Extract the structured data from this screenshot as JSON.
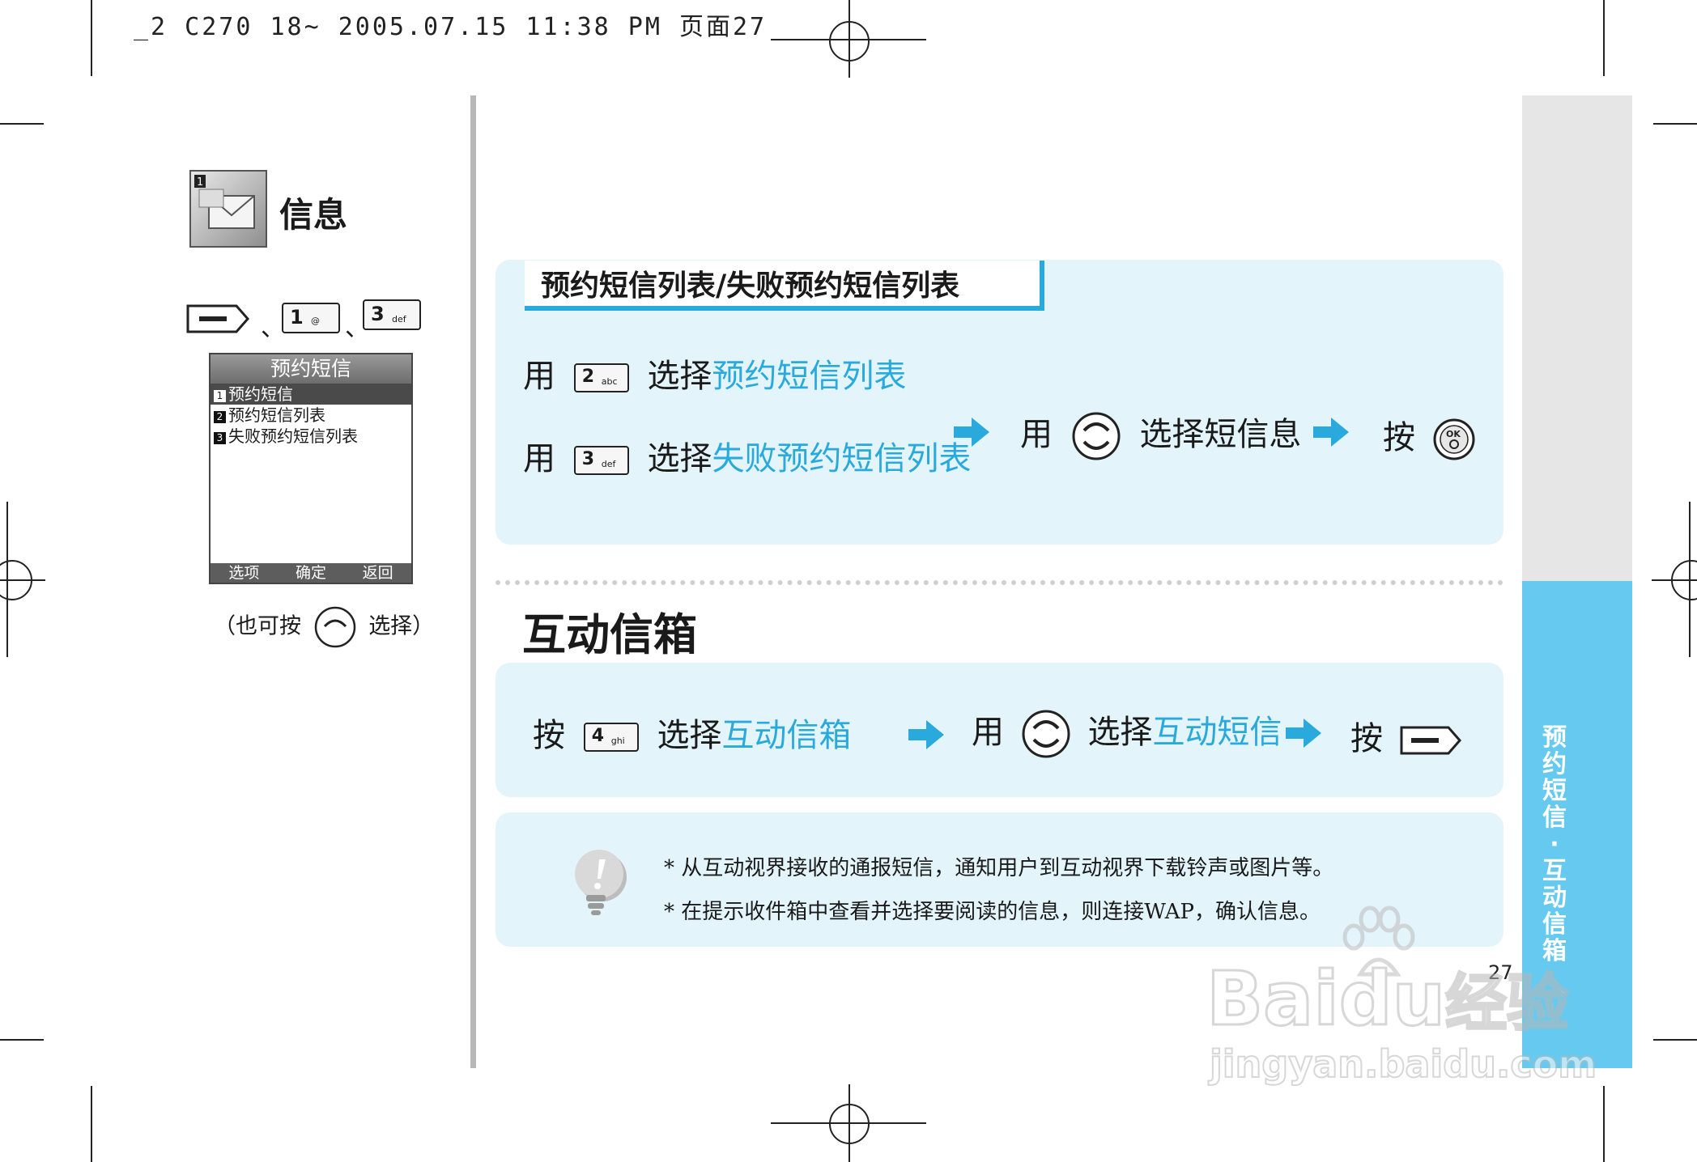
{
  "header": {
    "text": "_2 C270 18~ 2005.07.15 11:38 PM 页面27"
  },
  "left": {
    "section_title": "信息",
    "icon_name": "message-envelope-icon",
    "sep1": "、",
    "sep2": "、",
    "phone_screen": {
      "title": "预约短信",
      "items": [
        {
          "num": "1",
          "label": "预约短信"
        },
        {
          "num": "2",
          "label": "预约短信列表"
        },
        {
          "num": "3",
          "label": "失败预约短信列表"
        }
      ],
      "softkeys": [
        "选项",
        "确定",
        "返回"
      ]
    },
    "hint_open": "（也可按",
    "hint_close": "选择）"
  },
  "keys": {
    "k1": {
      "num": "1",
      "sub": ""
    },
    "k2": {
      "num": "2",
      "sub": "abc"
    },
    "k3": {
      "num": "3",
      "sub": "def"
    },
    "k4": {
      "num": "4",
      "sub": "ghi"
    },
    "ok": "OK"
  },
  "section1": {
    "tab_title": "预约短信列表/失败预约短信列表",
    "row1": {
      "prefix": "用",
      "action": "选择",
      "target": "预约短信列表"
    },
    "row2": {
      "prefix": "用",
      "action": "选择",
      "target": "失败预约短信列表"
    },
    "step2": {
      "prefix": "用",
      "text": "选择短信息"
    },
    "step3": {
      "prefix": "按"
    }
  },
  "section2": {
    "heading": "互动信箱",
    "step1": {
      "prefix": "按",
      "action": "选择",
      "target": "互动信箱"
    },
    "step2": {
      "prefix": "用",
      "action": "选择",
      "target": "互动短信"
    },
    "step3": {
      "prefix": "按"
    }
  },
  "notes": {
    "icon_name": "exclamation-bulb-icon",
    "lines": [
      "* 从互动视界接收的通报短信，通知用户到互动视界下载铃声或图片等。",
      "* 在提示收件箱中查看并选择要阅读的信息，则连接WAP，确认信息。"
    ]
  },
  "sidebar": {
    "text": "预约短信·互动信箱"
  },
  "page_number": "27",
  "watermark": {
    "brand": "Bai",
    "brand2": "du",
    "suffix": "经验",
    "url": "jingyan.baidu.com"
  },
  "colors": {
    "accent": "#29a9dc",
    "panel": "#e3f4fb",
    "sidebar": "#66c9ef"
  }
}
